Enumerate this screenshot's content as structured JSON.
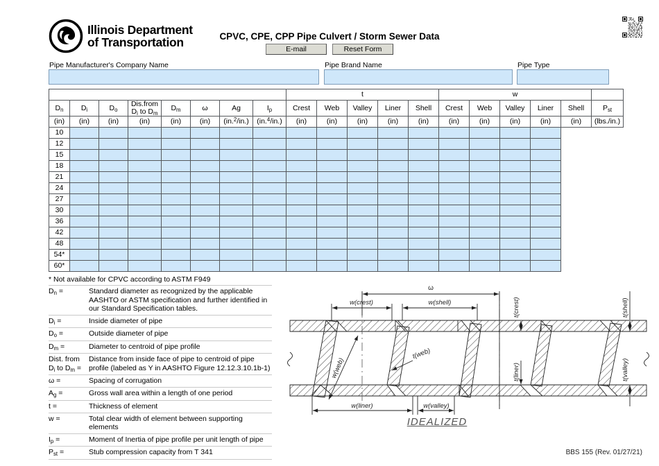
{
  "header": {
    "agency_line1": "Illinois Department",
    "agency_line2": "of Transportation",
    "title": "CPVC, CPE, CPP Pipe Culvert / Storm Sewer Data",
    "email_button": "E-mail",
    "reset_button": "Reset Form",
    "logo_icon": "idot-triskelion-logo",
    "qr_icon": "qr-code"
  },
  "fields": {
    "manufacturer": {
      "label": "Pipe Manufacturer's Company Name",
      "value": "",
      "placeholder": ""
    },
    "brand": {
      "label": "Pipe Brand Name",
      "value": "",
      "placeholder": ""
    },
    "type": {
      "label": "Pipe Type",
      "value": "",
      "placeholder": ""
    }
  },
  "table": {
    "group_headers": [
      {
        "label": "",
        "span": 8
      },
      {
        "label": "t",
        "span": 5
      },
      {
        "label": "w",
        "span": 5
      },
      {
        "label": "",
        "span": 1
      }
    ],
    "columns": [
      {
        "name": "D",
        "subscript": "n",
        "unit": "(in)"
      },
      {
        "name": "D",
        "subscript": "i",
        "unit": "(in)"
      },
      {
        "name": "D",
        "subscript": "o",
        "unit": "(in)"
      },
      {
        "name": "Dis.from",
        "name2": "D",
        "sub2a": "i",
        "mid": " to D",
        "sub2b": "m",
        "unit": "(in)"
      },
      {
        "name": "D",
        "subscript": "m",
        "unit": "(in)"
      },
      {
        "name": "ω",
        "subscript": "",
        "unit": "(in)"
      },
      {
        "name": "Ag",
        "subscript": "",
        "unit": "(in.2/in.)"
      },
      {
        "name": "I",
        "subscript": "p",
        "unit": "(in.4/in.)"
      },
      {
        "name": "Crest",
        "subscript": "",
        "unit": "(in)"
      },
      {
        "name": "Web",
        "subscript": "",
        "unit": "(in)"
      },
      {
        "name": "Valley",
        "subscript": "",
        "unit": "(in)"
      },
      {
        "name": "Liner",
        "subscript": "",
        "unit": "(in)"
      },
      {
        "name": "Shell",
        "subscript": "",
        "unit": "(in)"
      },
      {
        "name": "Crest",
        "subscript": "",
        "unit": "(in)"
      },
      {
        "name": "Web",
        "subscript": "",
        "unit": "(in)"
      },
      {
        "name": "Valley",
        "subscript": "",
        "unit": "(in)"
      },
      {
        "name": "Liner",
        "subscript": "",
        "unit": "(in)"
      },
      {
        "name": "Shell",
        "subscript": "",
        "unit": "(in)"
      },
      {
        "name": "P",
        "subscript": "st",
        "unit": "(lbs./in.)"
      }
    ],
    "rows": [
      "10",
      "12",
      "15",
      "18",
      "21",
      "24",
      "27",
      "30",
      "36",
      "42",
      "48",
      "54*",
      "60*"
    ],
    "data_columns": 16
  },
  "footnote": "* Not available for CPVC according to ASTM  F949",
  "legend": [
    {
      "sym_html": "D<sub>n</sub> =",
      "def": "Standard diameter as recognized by the applicable AASHTO or ASTM specification and further identified in our Standard Specification tables."
    },
    {
      "sym_html": "D<sub>i</sub> =",
      "def": "Inside diameter of pipe"
    },
    {
      "sym_html": "D<sub>o</sub> =",
      "def": "Outside diameter of pipe"
    },
    {
      "sym_html": "D<sub>m</sub> =",
      "def": "Diameter to centroid of pipe profile"
    },
    {
      "sym_html": "Dist. from<br>D<sub>i</sub> to D<sub>m</sub> =",
      "def": "Distance from inside face of pipe to centroid of pipe profile (labeled as Y in AASHTO Figure 12.12.3.10.1b-1)"
    },
    {
      "sym_html": "ω =",
      "def": "Spacing of corrugation"
    },
    {
      "sym_html": "A<sub>g</sub> =",
      "def": "Gross wall area within a length of one period"
    },
    {
      "sym_html": "t =",
      "def": "Thickness of element"
    },
    {
      "sym_html": "w =",
      "def": "Total clear width of element between supporting elements"
    },
    {
      "sym_html": "I<sub>p</sub> =",
      "def": "Moment of Inertia of pipe profile per unit length of pipe"
    },
    {
      "sym_html": "P<sub>st</sub> =",
      "def": "Stub compression capacity from T 341"
    }
  ],
  "diagram": {
    "caption": "IDEALIZED",
    "labels": {
      "omega": "ω",
      "w_crest": "w(crest)",
      "w_shell": "w(shell)",
      "w_web": "w(web)",
      "t_web": "t(web)",
      "w_liner": "w(liner)",
      "w_valley": "w(valley)",
      "t_crest": "t(crest)",
      "t_shell": "t(shell)",
      "t_liner": "t(liner)",
      "t_valley": "t(valley)"
    }
  },
  "footer": "BBS 155 (Rev. 01/27/21)"
}
